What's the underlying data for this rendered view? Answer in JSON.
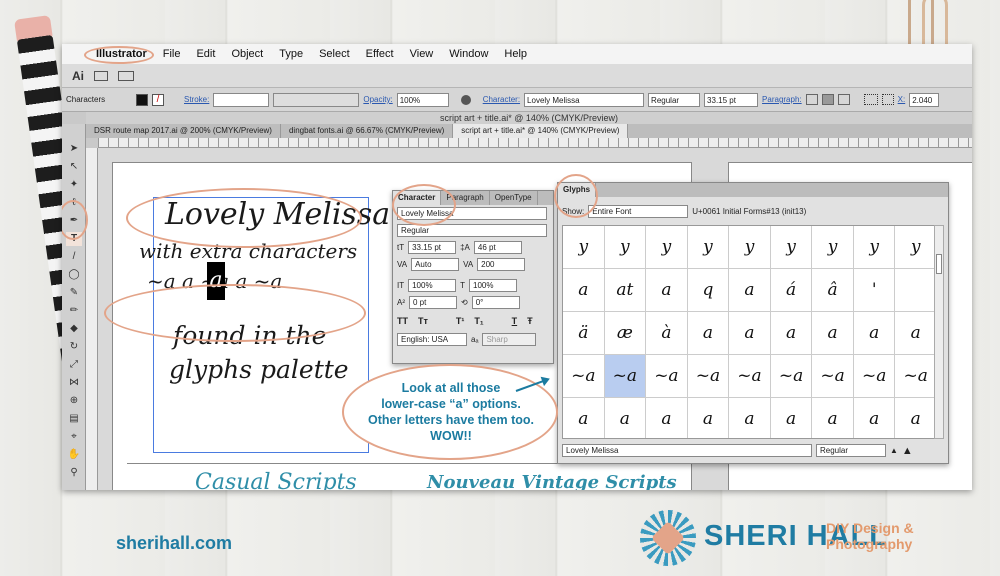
{
  "menu": {
    "apple": "",
    "items": [
      "Illustrator",
      "File",
      "Edit",
      "Object",
      "Type",
      "Select",
      "Effect",
      "View",
      "Window",
      "Help"
    ]
  },
  "appbar": {
    "logo": "Ai"
  },
  "control_bar": {
    "mode": "Characters",
    "stroke_label": "Stroke:",
    "opacity_label": "Opacity:",
    "opacity_value": "100%",
    "character_label": "Character:",
    "font": "Lovely Melissa",
    "style": "Regular",
    "size": "33.15 pt",
    "paragraph_label": "Paragraph:",
    "x_label": "X:",
    "x_value": "2.040"
  },
  "window_title": "script art + title.ai* @ 140% (CMYK/Preview)",
  "doc_tabs": [
    "DSR route map 2017.ai @ 200% (CMYK/Preview)",
    "dingbat fonts.ai @ 66.67% (CMYK/Preview)",
    "script art + title.ai* @ 140% (CMYK/Preview)"
  ],
  "artboard": {
    "line1": "Lovely Melissa",
    "line2": "with extra characters",
    "line3": "~a  a  ~a  a  ~a",
    "selected_char": "a",
    "line4": "found in the",
    "line5": "glyphs palette",
    "footer_left": "Casual Scripts",
    "footer_right": "Nouveau Vintage Scripts"
  },
  "character_panel": {
    "tabs": [
      "Character",
      "Paragraph",
      "OpenType"
    ],
    "font": "Lovely Melissa",
    "style": "Regular",
    "size": "33.15 pt",
    "leading": "46 pt",
    "kerning": "Auto",
    "tracking": "200",
    "vscale": "100%",
    "hscale": "100%",
    "baseline": "0 pt",
    "rotation": "0°",
    "type_buttons": [
      "TT",
      "Tт",
      "T¹",
      "T₁",
      "T",
      "Ŧ"
    ],
    "language": "English: USA",
    "aa_label": "aₐ",
    "aa_method": "Sharp"
  },
  "glyphs_panel": {
    "tab": "Glyphs",
    "show_label": "Show:",
    "show_value": "Entire Font",
    "glyph_info": "U+0061 Initial Forms#13 (init13)",
    "cells": [
      "y",
      "y",
      "y",
      "y",
      "y",
      "y",
      "y",
      "y",
      "y",
      "a",
      "at",
      "a",
      "q",
      "a",
      "á",
      "â",
      "'",
      "",
      "ä",
      "æ",
      "à",
      "a",
      "a",
      "a",
      "a",
      "a",
      "a",
      "~a",
      "~a",
      "~a",
      "~a",
      "~a",
      "~a",
      "~a",
      "~a",
      "~a",
      "a",
      "a",
      "a",
      "a",
      "a",
      "a",
      "a",
      "a",
      "a"
    ],
    "selected_index": 28,
    "font": "Lovely Melissa",
    "style": "Regular"
  },
  "annotation": {
    "lines": [
      "Look at all those",
      "lower-case “a” options.",
      "Other letters have them too.",
      "WOW!!"
    ]
  },
  "branding": {
    "site": "sherihall.com",
    "name": "SHERI HALL",
    "tag1": "DIY Design &",
    "tag2": "Photography"
  },
  "colors": {
    "accent": "#1b7ba0",
    "highlight": "#e3a489",
    "selection": "#b9cdf0"
  }
}
